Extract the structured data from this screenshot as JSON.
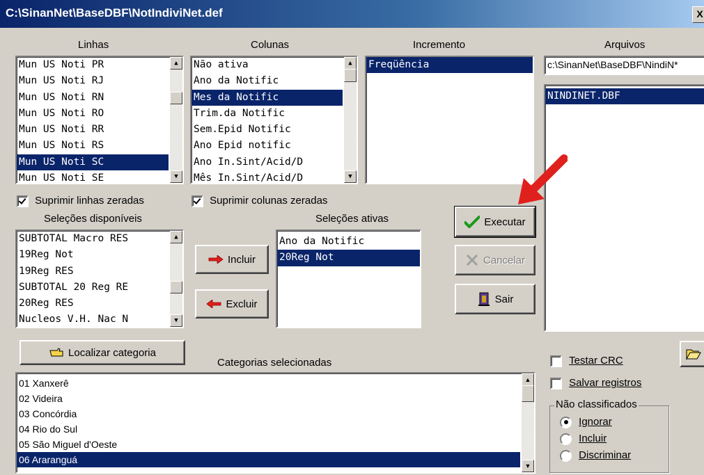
{
  "window": {
    "title": "C:\\SinanNet\\BaseDBF\\NotIndiviNet.def",
    "close_glyph": "X"
  },
  "linhas": {
    "label": "Linhas",
    "items": [
      "Mun US Noti PR",
      "Mun US Noti RJ",
      "Mun US Noti RN",
      "Mun US Noti RO",
      "Mun US Noti RR",
      "Mun US Noti RS",
      "Mun US Noti SC",
      "Mun US Noti SE"
    ],
    "selected": 6
  },
  "colunas": {
    "label": "Colunas",
    "items": [
      "Não ativa",
      "Ano da Notific",
      "Mes da Notific",
      "Trim.da Notific",
      "Sem.Epid Notific",
      "Ano Epid notific",
      "Ano In.Sint/Acid/D",
      "Mês In.Sint/Acid/D"
    ],
    "selected": 2
  },
  "incremento": {
    "label": "Incremento",
    "items": [
      "Freqüência"
    ],
    "selected": 0
  },
  "arquivos": {
    "label": "Arquivos",
    "path": "c:\\SinanNet\\BaseDBF\\NindiN*",
    "files": [
      "NINDINET.DBF"
    ]
  },
  "suprimir_linhas": {
    "label": "Suprimir linhas zeradas",
    "checked": true
  },
  "suprimir_colunas": {
    "label": "Suprimir colunas zeradas",
    "checked": true
  },
  "selecoes_disponiveis": {
    "label": "Seleções disponíveis",
    "items": [
      "SUBTOTAL Macro RES",
      "19Reg Not",
      "19Reg RES",
      "SUBTOTAL 20 Reg RE",
      "20Reg RES",
      "Nucleos V.H. Nac N"
    ]
  },
  "selecoes_ativas": {
    "label": "Seleções ativas",
    "items": [
      "Ano da Notific",
      "20Reg Not"
    ],
    "selected": 1
  },
  "buttons": {
    "incluir": "Incluir",
    "excluir": "Excluir",
    "executar": "Executar",
    "cancelar": "Cancelar",
    "sair": "Sair",
    "localizar": "Localizar categoria"
  },
  "categorias": {
    "label": "Categorias selecionadas",
    "items": [
      "01 Xanxerê",
      "02 Videira",
      "03 Concórdia",
      "04 Rio do Sul",
      "05 São Miguel d'Oeste",
      "06 Araranguá"
    ],
    "selected": 5
  },
  "options": {
    "testar_crc": "Testar CRC",
    "salvar_registros": "Salvar registros"
  },
  "nao_classificados": {
    "label": "Não classificados",
    "options": [
      "Ignorar",
      "Incluir",
      "Discriminar"
    ],
    "selected": 0
  },
  "colors": {
    "selection": "#0a246a",
    "face": "#d4d0c8",
    "annotation_arrow": "#e0201c"
  }
}
